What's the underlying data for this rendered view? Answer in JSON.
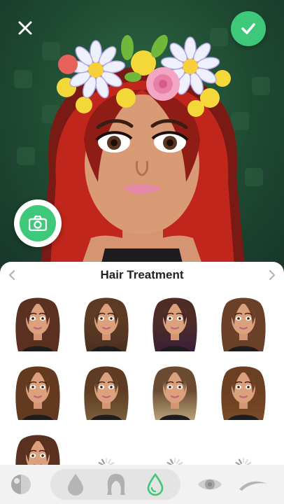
{
  "panel": {
    "title": "Hair Treatment"
  },
  "hair_options": [
    {
      "color": "#5a3020",
      "tip": "#5a3020",
      "selected": false
    },
    {
      "color": "#5d3a24",
      "tip": "#4a3020",
      "selected": false
    },
    {
      "color": "#4e2c25",
      "tip": "#3a1f3a",
      "selected": false
    },
    {
      "color": "#6a4028",
      "tip": "#6a4028",
      "selected": false
    },
    {
      "color": "#63391f",
      "tip": "#63391f",
      "selected": false
    },
    {
      "color": "#5e3b22",
      "tip": "#7a5f3a",
      "selected": false
    },
    {
      "color": "#6a4a30",
      "tip": "#b8a27a",
      "selected": false
    },
    {
      "color": "#6b3f22",
      "tip": "#7a4a28",
      "selected": false
    },
    {
      "color": "#5a3020",
      "tip": "#5a3020",
      "selected": false
    }
  ],
  "loading_slots": 3,
  "colors": {
    "accent": "#3ec97a",
    "background": "#1f4a32"
  },
  "icons": {
    "close": "close-icon",
    "confirm": "checkmark-icon",
    "camera": "camera-icon",
    "categories": [
      "face-tone-icon",
      "skin-drop-icon",
      "hair-style-icon",
      "hair-treatment-icon",
      "eye-icon",
      "eyebrow-icon"
    ]
  }
}
